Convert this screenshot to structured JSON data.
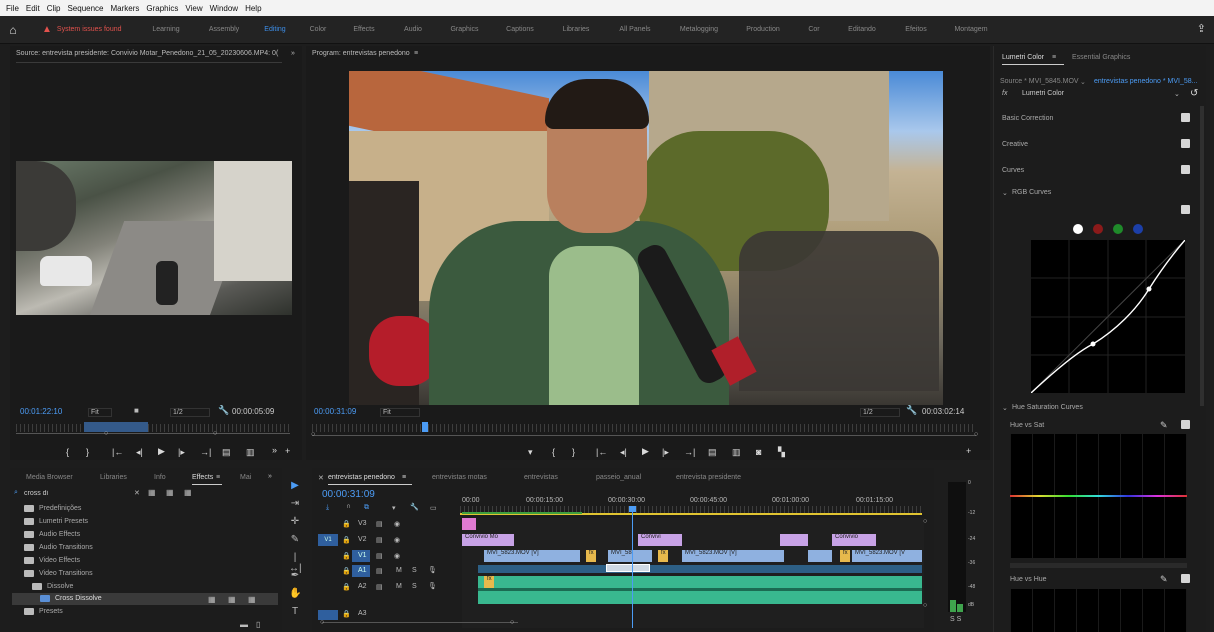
{
  "menu": [
    "File",
    "Edit",
    "Clip",
    "Sequence",
    "Markers",
    "Graphics",
    "View",
    "Window",
    "Help"
  ],
  "workspace": {
    "issue": "System issues found",
    "tabs": [
      "Learning",
      "Assembly",
      "Editing",
      "Color",
      "Effects",
      "Audio",
      "Graphics",
      "Captions",
      "Libraries",
      "All Panels",
      "Metalogging",
      "Production",
      "Cor",
      "Editando",
      "Efeitos",
      "Montagem"
    ],
    "active": "Editing"
  },
  "source": {
    "title": "Source: entrevista presidente: Convivio Motar_Penedono_21_05_20230606.MP4: 0(",
    "tc_left": "00:01:22:10",
    "fit": "Fit",
    "ratio": "1/2",
    "tc_right": "00:00:05:09"
  },
  "program": {
    "title": "Program: entrevistas penedono",
    "tc_left": "00:00:31:09",
    "fit": "Fit",
    "ratio": "1/2",
    "tc_right": "00:03:02:14"
  },
  "lumetri": {
    "tab1": "Lumetri Color",
    "tab2": "Essential Graphics",
    "source_line": "Source * MVI_5845.MOV",
    "seq_line": "entrevistas penedono * MVI_58...",
    "fx": "Lumetri Color",
    "sections": [
      "Basic Correction",
      "Creative",
      "Curves"
    ],
    "rgb": "RGB Curves",
    "hsc": "Hue Saturation Curves",
    "hue_vs_sat": "Hue vs Sat",
    "hue_vs_hue": "Hue vs Hue",
    "curve_color": "#ffffff"
  },
  "effects_panel": {
    "tabs": [
      "Media Browser",
      "Libraries",
      "Info",
      "Effects",
      "Mai"
    ],
    "search": "cross di",
    "items": [
      "Predefinições",
      "Lumetri Presets",
      "Audio Effects",
      "Audio Transitions",
      "Video Effects",
      "Video Transitions",
      "Dissolve",
      "Cross Dissolve",
      "Presets"
    ]
  },
  "timeline": {
    "tabs": [
      "entrevistas penedono",
      "entrevistas motas",
      "entrevistas",
      "passeio_anual",
      "entrevista presidente"
    ],
    "tc": "00:00:31:09",
    "ruler": [
      "00:00",
      "00:00:15:00",
      "00:00:30:00",
      "00:00:45:00",
      "00:01:00:00",
      "00:01:15:00"
    ],
    "tracks": [
      "V3",
      "V2",
      "V1",
      "A1",
      "A2",
      "A3"
    ],
    "title_clips": [
      "Convivio Mo",
      "Convivi",
      "Convivio"
    ],
    "video_clips": [
      "MVI_5823.MOV [V]",
      "MVI_58",
      "MVI_5823.MOV [V]",
      "MVI_5823.MOV [V"
    ],
    "fx_badge": "fx",
    "source_patch": "V1",
    "audio_patch": "A1"
  },
  "meter_labels": [
    "0",
    "-12",
    "-24",
    "-36",
    "-48",
    "dB"
  ],
  "meter_solo": "S S"
}
